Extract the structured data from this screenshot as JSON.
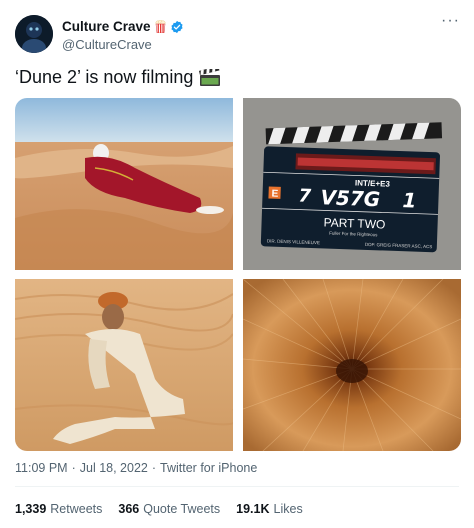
{
  "author": {
    "display_name": "Culture Crave",
    "handle": "@CultureCrave",
    "badge_emoji": "popcorn",
    "verified": true
  },
  "tweet": {
    "text": "‘Dune 2’ is now filming",
    "emoji": "clapper-board"
  },
  "media": {
    "clapperboard": {
      "scene": "INT/E+E3",
      "roll": "V57G",
      "take": "1",
      "marker": "E",
      "slate_number": "7",
      "title": "PART TWO",
      "director_line": "DIR. DENIS VILLENEUVE",
      "dop_line": "DOP. GREIG FRASER ASC, ACS",
      "subtitle_line": "Fuller For the Righteous"
    }
  },
  "meta": {
    "time": "11:09 PM",
    "separator": "·",
    "date": "Jul 18, 2022",
    "source": "Twitter for iPhone"
  },
  "stats": {
    "retweets_count": "1,339",
    "retweets_label": "Retweets",
    "quotes_count": "366",
    "quotes_label": "Quote Tweets",
    "likes_count": "19.1K",
    "likes_label": "Likes"
  },
  "colors": {
    "verified_blue": "#1d9bf0",
    "secondary_text": "#536471",
    "sand": "#d9a875",
    "sky": "#9fc3de"
  }
}
